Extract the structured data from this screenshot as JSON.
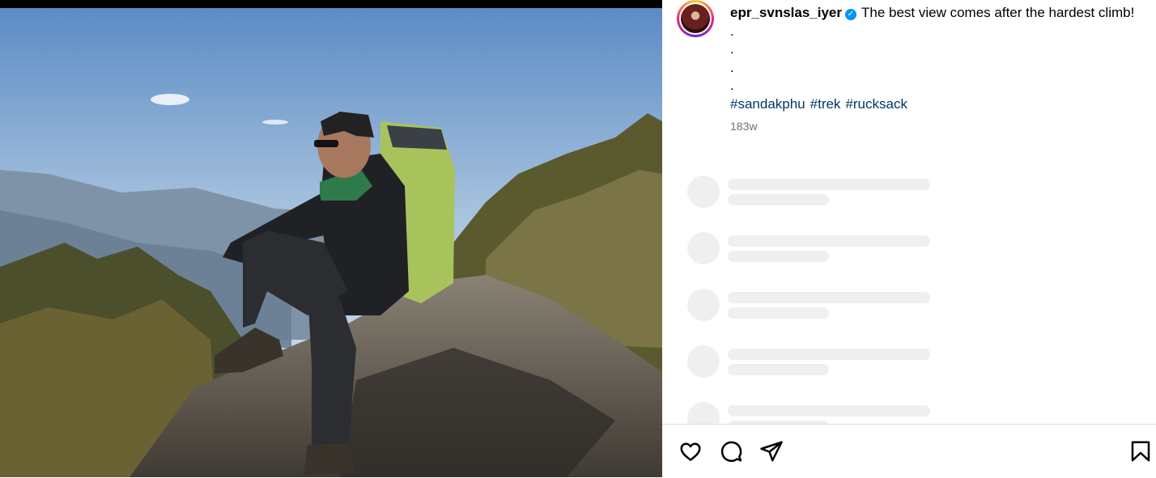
{
  "post": {
    "username": "epr_svnslas_iyer",
    "verified_glyph": "✓",
    "caption_text": "The best view comes after the hardest climb!",
    "caption_dots": [
      ".",
      ".",
      ".",
      "."
    ],
    "hashtags": [
      "#sandakphu",
      "#trek",
      "#rucksack"
    ],
    "age": "183w"
  },
  "icons": {
    "like": "heart-icon",
    "comment": "comment-icon",
    "share": "share-icon",
    "save": "bookmark-icon"
  },
  "colors": {
    "link": "#00376b",
    "verified": "#0095f6",
    "muted": "#737373",
    "skeleton": "#efefef"
  }
}
